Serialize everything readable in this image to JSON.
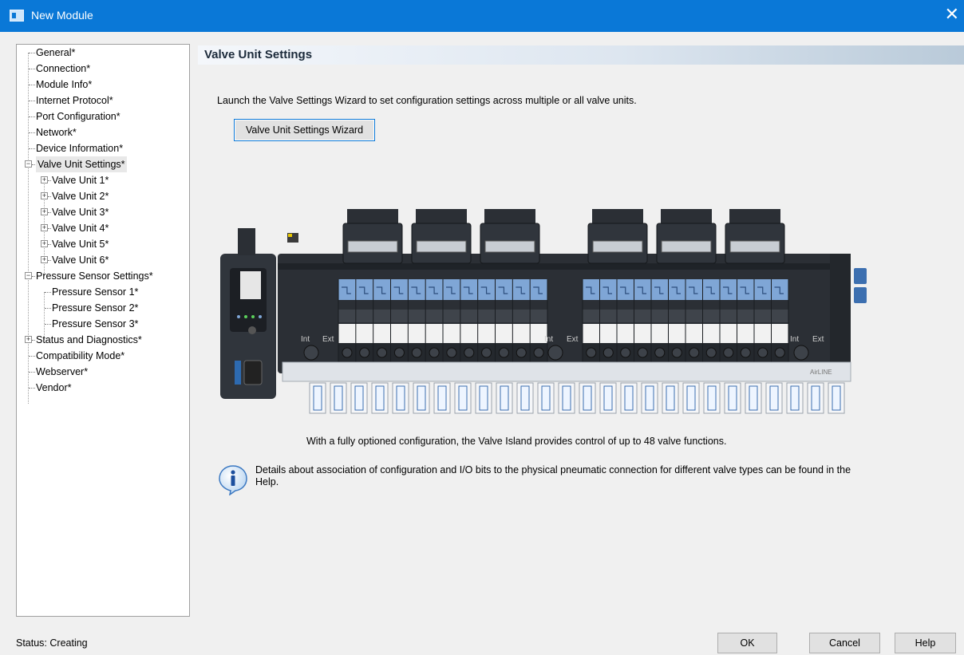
{
  "window": {
    "title": "New Module",
    "close_glyph": "✕"
  },
  "tree": {
    "items": [
      {
        "label": "General*"
      },
      {
        "label": "Connection*"
      },
      {
        "label": "Module Info*"
      },
      {
        "label": "Internet Protocol*"
      },
      {
        "label": "Port Configuration*"
      },
      {
        "label": "Network*"
      },
      {
        "label": "Device Information*"
      },
      {
        "label": "Valve Unit Settings*",
        "expanded": true
      },
      {
        "label": "Valve Unit 1*",
        "expanded": false
      },
      {
        "label": "Valve Unit 2*",
        "expanded": false
      },
      {
        "label": "Valve Unit 3*",
        "expanded": false
      },
      {
        "label": "Valve Unit 4*",
        "expanded": false
      },
      {
        "label": "Valve Unit 5*",
        "expanded": false
      },
      {
        "label": "Valve Unit 6*",
        "expanded": false
      },
      {
        "label": "Pressure Sensor Settings*",
        "expanded": true
      },
      {
        "label": "Pressure Sensor 1*"
      },
      {
        "label": "Pressure Sensor 2*"
      },
      {
        "label": "Pressure Sensor 3*"
      },
      {
        "label": "Status and Diagnostics*",
        "expanded": false
      },
      {
        "label": "Compatibility Mode*"
      },
      {
        "label": "Webserver*"
      },
      {
        "label": "Vendor*"
      }
    ]
  },
  "main": {
    "section_title": "Valve Unit Settings",
    "description": "Launch the Valve Settings Wizard to set configuration settings across multiple or all valve units.",
    "wizard_button": "Valve Unit Settings Wizard",
    "graphic": {
      "port_labels": [
        "Int",
        "Ext",
        "Int",
        "Ext",
        "Int",
        "Ext"
      ],
      "brand": "AirLINE"
    },
    "caption": "With a fully optioned configuration, the Valve Island provides control of up to 48 valve functions.",
    "info_text": "Details about association of configuration and I/O bits to the physical pneumatic connection for different valve types can be found in the Help."
  },
  "footer": {
    "status": "Status:  Creating",
    "ok": "OK",
    "cancel": "Cancel",
    "help": "Help"
  },
  "colors": {
    "title_bar": "#0a78d7",
    "valve_blue": "#7fa6d6",
    "body_dark": "#2b2f35"
  }
}
